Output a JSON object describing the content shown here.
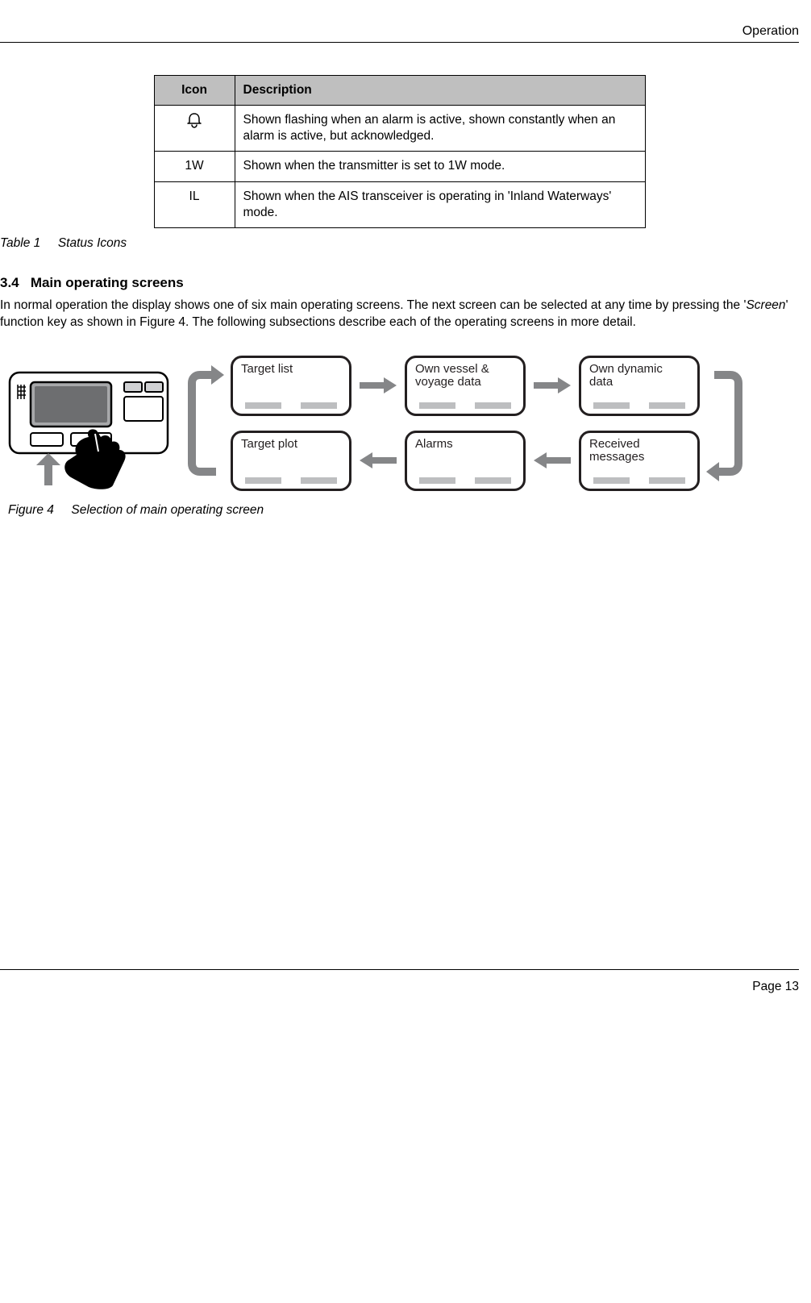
{
  "header": {
    "section": "Operation"
  },
  "table": {
    "headers": {
      "icon": "Icon",
      "desc": "Description"
    },
    "rows": [
      {
        "icon": "bell",
        "desc": "Shown flashing when an alarm is active, shown constantly when an alarm is active, but acknowledged."
      },
      {
        "icon": "1W",
        "desc": "Shown when the transmitter is set to 1W mode."
      },
      {
        "icon": "IL",
        "desc": "Shown when the AIS transceiver is operating in 'Inland Waterways' mode."
      }
    ],
    "caption_prefix": "Table 1",
    "caption_title": "Status Icons"
  },
  "section": {
    "number": "3.4",
    "title": "Main operating screens",
    "body_a": "In normal operation the display shows one of six main operating screens. The next screen can be selected at any time by pressing the '",
    "body_italic": "Screen",
    "body_b": "' function key as shown in Figure 4. The following subsections describe each of the operating screens in more detail."
  },
  "figure": {
    "screens": {
      "target_list": "Target list",
      "own_vessel": "Own vessel & voyage data",
      "own_dynamic": "Own dynamic data",
      "target_plot": "Target plot",
      "alarms": "Alarms",
      "received": "Received messages"
    },
    "caption_prefix": "Figure 4",
    "caption_title": "Selection of main operating screen"
  },
  "footer": {
    "page": "Page 13"
  }
}
